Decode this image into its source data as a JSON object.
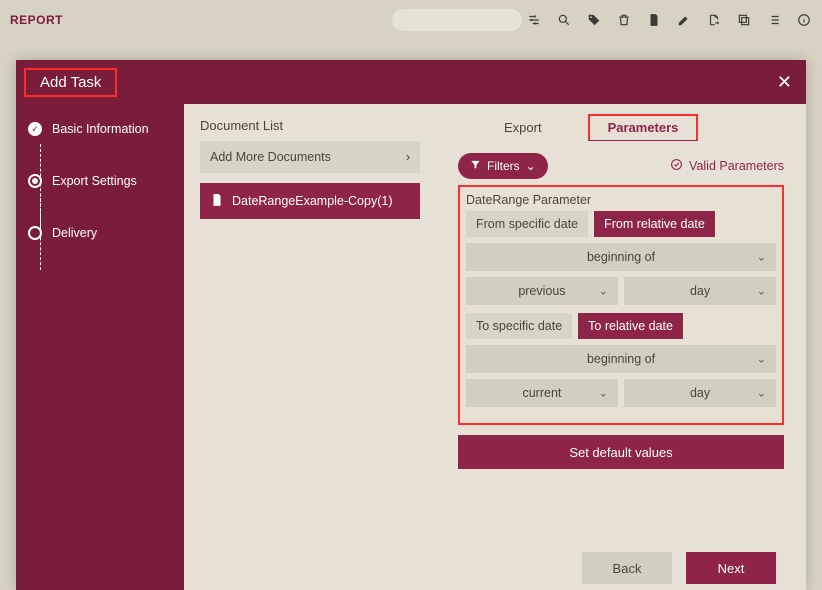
{
  "topbar": {
    "title": "REPORT"
  },
  "modal": {
    "title": "Add Task"
  },
  "steps": [
    "Basic Information",
    "Export Settings",
    "Delivery"
  ],
  "doc": {
    "list_title": "Document List",
    "add_more": "Add More Documents",
    "item": "DateRangeExample-Copy(1)"
  },
  "tabs": {
    "export": "Export",
    "parameters": "Parameters"
  },
  "filters": {
    "label": "Filters",
    "valid": "Valid Parameters"
  },
  "param": {
    "section_label": "DateRange Parameter",
    "from_specific": "From specific date",
    "from_relative": "From relative date",
    "beginning_of": "beginning of",
    "previous": "previous",
    "day": "day",
    "to_specific": "To specific date",
    "to_relative": "To relative date",
    "beginning_of2": "beginning of",
    "current": "current",
    "day2": "day",
    "set_defaults": "Set default values"
  },
  "footer": {
    "back": "Back",
    "next": "Next"
  }
}
